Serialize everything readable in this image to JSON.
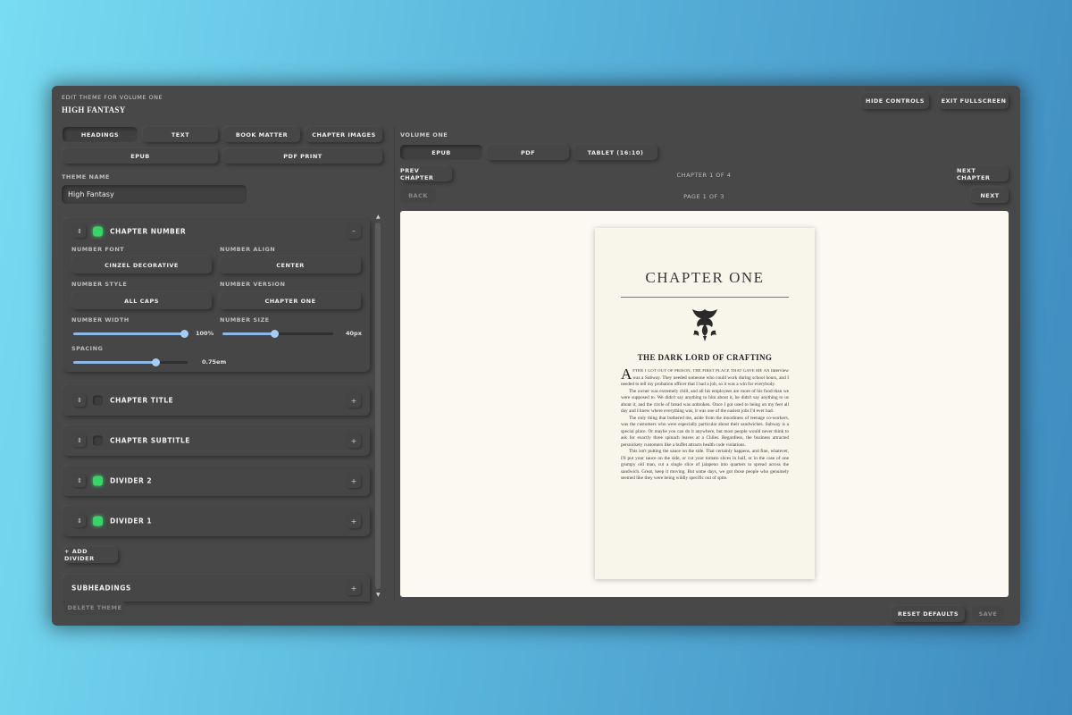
{
  "header": {
    "edit_label": "EDIT THEME FOR VOLUME ONE",
    "theme_logo": "HIGH FANTASY",
    "hide_controls": "HIDE CONTROLS",
    "exit_fullscreen": "EXIT FULLSCREEN"
  },
  "tabs": {
    "headings": "HEADINGS",
    "text": "TEXT",
    "book_matter": "BOOK MATTER",
    "chapter_images": "CHAPTER IMAGES",
    "epub": "EPUB",
    "pdf_print": "PDF PRINT"
  },
  "theme_name": {
    "label": "THEME NAME",
    "value": "High Fantasy"
  },
  "chapter_number": {
    "title": "CHAPTER NUMBER",
    "enabled": true,
    "number_font_label": "NUMBER FONT",
    "number_font": "CINZEL DECORATIVE",
    "number_align_label": "NUMBER ALIGN",
    "number_align": "CENTER",
    "number_style_label": "NUMBER STYLE",
    "number_style": "ALL CAPS",
    "number_version_label": "NUMBER VERSION",
    "number_version": "CHAPTER ONE",
    "number_width_label": "NUMBER WIDTH",
    "number_width": "100%",
    "number_width_fraction": 1.0,
    "number_size_label": "NUMBER SIZE",
    "number_size": "40px",
    "number_size_fraction": 0.47,
    "spacing_label": "SPACING",
    "spacing": "0.75em",
    "spacing_fraction": 0.72,
    "collapse_glyph": "–"
  },
  "sections": [
    {
      "title": "CHAPTER TITLE",
      "enabled": false,
      "glyph": "+"
    },
    {
      "title": "CHAPTER SUBTITLE",
      "enabled": false,
      "glyph": "+"
    },
    {
      "title": "DIVIDER 2",
      "enabled": true,
      "glyph": "+"
    },
    {
      "title": "DIVIDER 1",
      "enabled": true,
      "glyph": "+"
    }
  ],
  "add_divider": "+ ADD DIVIDER",
  "subheadings": {
    "title": "SUBHEADINGS",
    "glyph": "+"
  },
  "delete_theme": "DELETE THEME",
  "preview": {
    "volume_label": "VOLUME ONE",
    "formats": [
      "EPUB",
      "PDF",
      "TABLET (16:10)"
    ],
    "prev_chapter": "PREV CHAPTER",
    "chapter_indicator": "CHAPTER 1 OF 4",
    "next_chapter": "NEXT CHAPTER",
    "back": "BACK",
    "page_indicator": "PAGE 1 OF 3",
    "next": "NEXT"
  },
  "page": {
    "chapter_heading": "CHAPTER ONE",
    "chapter_title": "THE DARK LORD OF CRAFTING",
    "dropcap": "A",
    "p1_smallcaps": "FTER I GOT OUT OF PRISON, THE FIRST PLACE THAT GAVE ME AN",
    "p1_rest": "interview was a Subway. They needed someone who could work during school hours, and I needed to tell my probation officer that I had a job, so it was a win for everybody.",
    "p2": "The owner was extremely chill, and all his employees are more of his food than we were supposed to. We didn't say anything to him about it, he didn't say anything to us about it, and the circle of bread was unbroken. Once I got used to being on my feet all day and I knew where everything was, it was one of the easiest jobs I'd ever had.",
    "p3": "The only thing that bothered me, aside from the moodiness of teenage co-workers, was the customers who were especially particular about their sandwiches. Subway is a special place. Or maybe you can do it anywhere, but most people would never think to ask for exactly three spinach leaves at a Chiles. Regardless, the business attracted persnickety customers like a buffet attracts health code violations.",
    "p4": "This isn't putting the sauce on the side. That certainly happens, and fine, whatever, I'll put your sauce on the side, or cut your tomato slices in half, or in the case of one grumpy old man, cut a single slice of jalapeno into quarters to spread across the sandwich. Great, keep it moving. But some days, we got those people who genuinely seemed like they were being wildly specific out of spite."
  },
  "footer": {
    "reset_defaults": "RESET DEFAULTS",
    "save": "SAVE"
  },
  "colors": {
    "panel": "#484848",
    "led_on": "#3ad36a",
    "slider_fill": "#8cb8e6",
    "paper": "#f8f5ea"
  }
}
